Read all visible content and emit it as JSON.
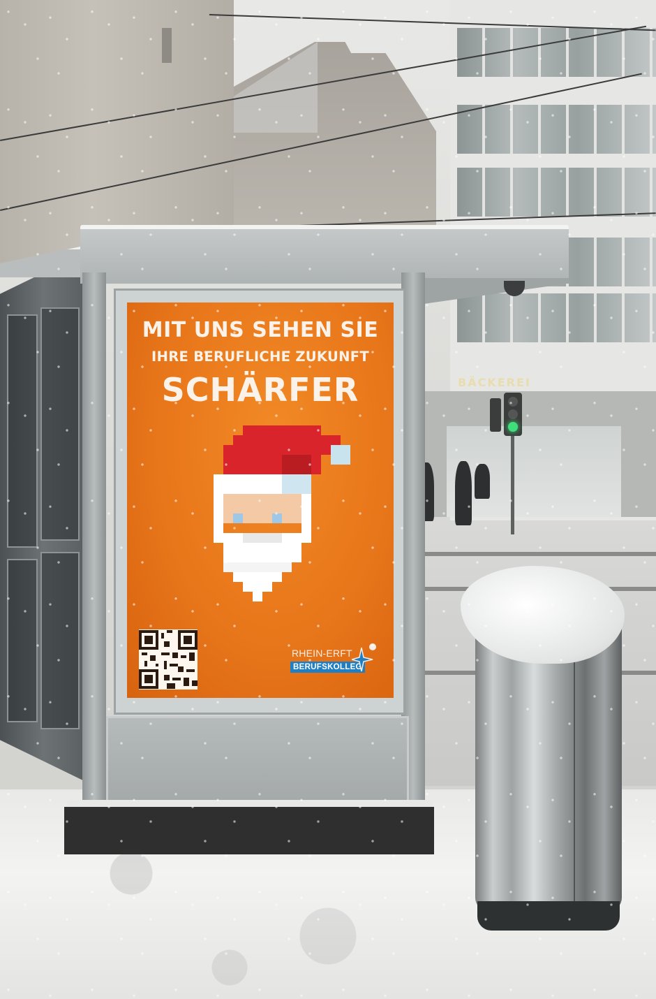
{
  "poster": {
    "headline_line1": "MIT UNS SEHEN SIE",
    "headline_line2": "IHRE BERUFLICHE ZUKUNFT",
    "headline_line3": "SCHÄRFER",
    "logo_top": "RHEIN-ERFT",
    "logo_bottom": "BERUFSKOLLEG",
    "background_color": "#e8761a",
    "logo_color": "#1f7fc2"
  },
  "storefront": {
    "sign": "BÄCKEREI"
  },
  "traffic_light": {
    "state": "green"
  }
}
